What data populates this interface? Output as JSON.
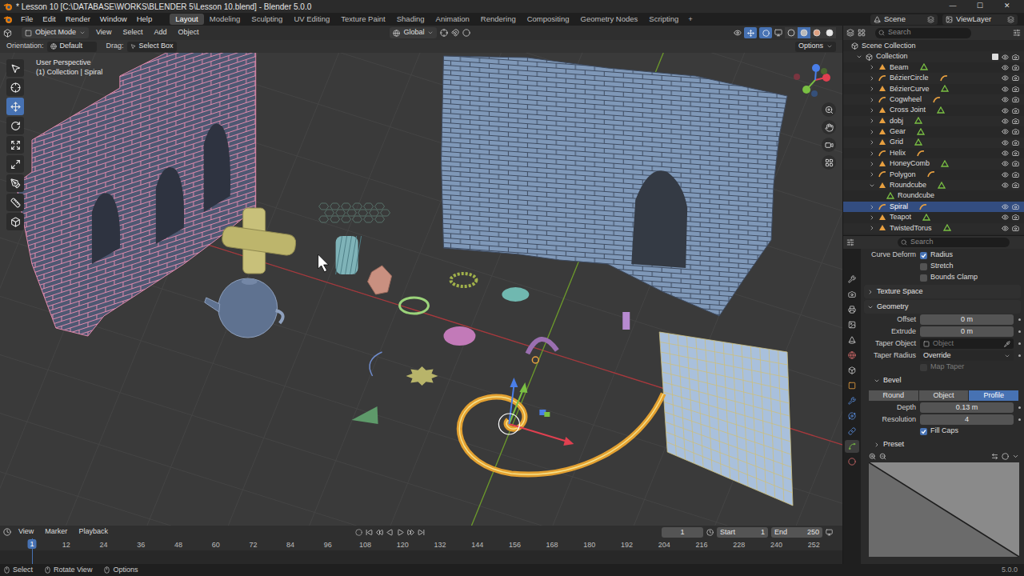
{
  "window": {
    "title": "* Lesson 10 [C:\\DATABASE\\WORKS\\BLENDER 5\\Lesson 10.blend] - Blender 5.0.0",
    "controls": [
      "—",
      "☐",
      "✕"
    ]
  },
  "menu": [
    "File",
    "Edit",
    "Render",
    "Window",
    "Help"
  ],
  "workspaces": [
    {
      "label": "Layout",
      "selected": true
    },
    {
      "label": "Modeling",
      "selected": false
    },
    {
      "label": "Sculpting",
      "selected": false
    },
    {
      "label": "UV Editing",
      "selected": false
    },
    {
      "label": "Texture Paint",
      "selected": false
    },
    {
      "label": "Shading",
      "selected": false
    },
    {
      "label": "Animation",
      "selected": false
    },
    {
      "label": "Rendering",
      "selected": false
    },
    {
      "label": "Compositing",
      "selected": false
    },
    {
      "label": "Geometry Nodes",
      "selected": false
    },
    {
      "label": "Scripting",
      "selected": false
    }
  ],
  "add_workspace": "+",
  "scene": "Scene",
  "view_layer": "ViewLayer",
  "viewport": {
    "mode": "Object Mode",
    "menus": [
      "View",
      "Select",
      "Add",
      "Object"
    ],
    "orientation": "Global",
    "tool_settings": {
      "orientation_label": "Orientation:",
      "orientation": "Default",
      "drag_label": "Drag:",
      "drag": "Select Box"
    },
    "options": "Options",
    "overlay": [
      "User Perspective",
      "(1) Collection | Spiral"
    ],
    "tools": [
      {
        "selected": false
      },
      {
        "selected": false
      },
      {
        "selected": true
      },
      {
        "selected": false
      },
      {
        "selected": false
      },
      {
        "selected": false
      },
      {
        "selected": false
      },
      {
        "selected": false
      },
      {
        "selected": false
      }
    ]
  },
  "outliner": {
    "search": "Search",
    "scene_collection": "Scene Collection",
    "collection": "Collection",
    "items": [
      {
        "name": "Beam",
        "kind": "mesh",
        "child": false,
        "expanded": false,
        "selected": false
      },
      {
        "name": "BézierCircle",
        "kind": "curve",
        "child": false,
        "expanded": false,
        "selected": false
      },
      {
        "name": "BézierCurve",
        "kind": "mesh",
        "child": false,
        "expanded": false,
        "selected": false
      },
      {
        "name": "Cogwheel",
        "kind": "curve",
        "child": false,
        "expanded": false,
        "selected": false
      },
      {
        "name": "Cross Joint",
        "kind": "mesh",
        "child": false,
        "expanded": false,
        "selected": false
      },
      {
        "name": "dobj",
        "kind": "mesh",
        "child": false,
        "expanded": false,
        "selected": false
      },
      {
        "name": "Gear",
        "kind": "mesh",
        "child": false,
        "expanded": false,
        "selected": false
      },
      {
        "name": "Grid",
        "kind": "mesh",
        "child": false,
        "expanded": false,
        "selected": false
      },
      {
        "name": "Helix",
        "kind": "curve",
        "child": false,
        "expanded": false,
        "selected": false
      },
      {
        "name": "HoneyComb",
        "kind": "mesh",
        "child": false,
        "expanded": false,
        "selected": false
      },
      {
        "name": "Polygon",
        "kind": "curve",
        "child": false,
        "expanded": false,
        "selected": false
      },
      {
        "name": "Roundcube",
        "kind": "empty",
        "child": false,
        "expanded": true,
        "selected": false
      },
      {
        "name": "Roundcube",
        "kind": "mesh-data",
        "child": true,
        "expanded": false,
        "selected": false
      },
      {
        "name": "Spiral",
        "kind": "curve",
        "child": false,
        "expanded": false,
        "selected": true
      },
      {
        "name": "Teapot",
        "kind": "mesh",
        "child": false,
        "expanded": false,
        "selected": false
      },
      {
        "name": "TwistedTorus",
        "kind": "mesh",
        "child": false,
        "expanded": false,
        "selected": false
      }
    ]
  },
  "properties": {
    "search": "Search",
    "tabs": [
      {
        "selected": false
      },
      {
        "selected": false
      },
      {
        "selected": false
      },
      {
        "selected": false
      },
      {
        "selected": false
      },
      {
        "selected": false
      },
      {
        "selected": false
      },
      {
        "selected": false
      },
      {
        "selected": false
      },
      {
        "selected": false
      },
      {
        "selected": false
      },
      {
        "selected": true
      },
      {
        "selected": false
      }
    ],
    "rows": [
      {
        "kind": "checkbox",
        "lead": "Curve Deform",
        "label": "Radius",
        "checked": true,
        "disabled": false
      },
      {
        "kind": "checkbox",
        "label": "Stretch",
        "checked": false,
        "disabled": false
      },
      {
        "kind": "checkbox",
        "label": "Bounds Clamp",
        "checked": false,
        "disabled": false
      },
      {
        "kind": "panel",
        "label": "Texture Space",
        "expanded": false
      },
      {
        "kind": "panel",
        "label": "Geometry",
        "expanded": true
      },
      {
        "kind": "number",
        "label": "Offset",
        "value": "0 m"
      },
      {
        "kind": "number",
        "label": "Extrude",
        "value": "0 m"
      },
      {
        "kind": "object",
        "label": "Taper Object",
        "placeholder": "Object"
      },
      {
        "kind": "dropdown",
        "label": "Taper Radius",
        "value": "Override"
      },
      {
        "kind": "checkbox",
        "label": "Map Taper",
        "checked": false,
        "disabled": true
      },
      {
        "kind": "subpanel",
        "label": "Bevel",
        "expanded": true
      },
      {
        "kind": "segmented",
        "options": [
          {
            "label": "Round",
            "selected": false
          },
          {
            "label": "Object",
            "selected": false
          },
          {
            "label": "Profile",
            "selected": true
          }
        ]
      },
      {
        "kind": "number",
        "label": "Depth",
        "value": "0.13 m"
      },
      {
        "kind": "number",
        "label": "Resolution",
        "value": "4"
      },
      {
        "kind": "checkbox",
        "label": "Fill Caps",
        "checked": true,
        "disabled": false
      },
      {
        "kind": "subpanel",
        "label": "Preset",
        "expanded": false
      },
      {
        "kind": "curve"
      }
    ]
  },
  "timeline": {
    "menus": [
      "View",
      "Marker",
      "Playback"
    ],
    "frame": "1",
    "start_label": "Start",
    "start": "1",
    "end_label": "End",
    "end": "250",
    "current": "1",
    "ticks": [
      "12",
      "24",
      "36",
      "48",
      "60",
      "72",
      "84",
      "96",
      "108",
      "120",
      "132",
      "144",
      "156",
      "168",
      "180",
      "192",
      "204",
      "216",
      "228",
      "240",
      "252"
    ]
  },
  "status_bar": {
    "items": [
      "Select",
      "Rotate View",
      "Options"
    ],
    "version": "5.0.0"
  }
}
